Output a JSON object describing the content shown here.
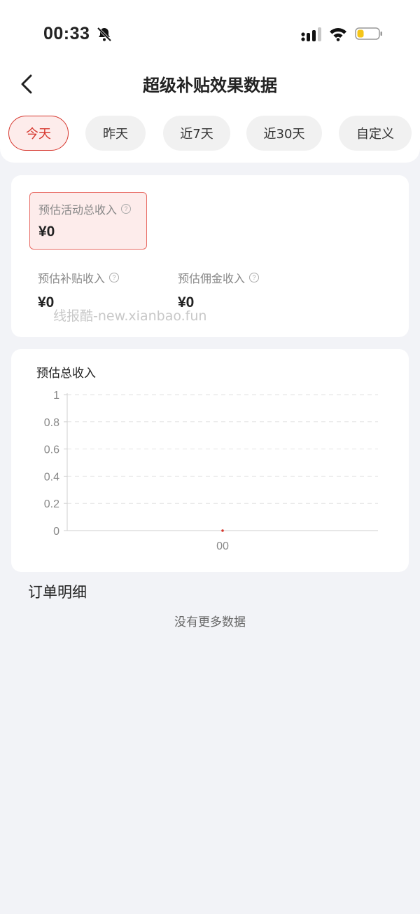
{
  "status_bar": {
    "time": "00:33"
  },
  "header": {
    "title": "超级补贴效果数据"
  },
  "tabs": [
    {
      "label": "今天",
      "active": true
    },
    {
      "label": "昨天",
      "active": false
    },
    {
      "label": "近7天",
      "active": false
    },
    {
      "label": "近30天",
      "active": false
    },
    {
      "label": "自定义",
      "active": false
    }
  ],
  "summary": {
    "total": {
      "label": "预估活动总收入",
      "value": "¥0"
    },
    "subsidy": {
      "label": "预估补贴收入",
      "value": "¥0"
    },
    "commission": {
      "label": "预估佣金收入",
      "value": "¥0"
    },
    "watermark": "线报酷-new.xianbao.fun"
  },
  "chart": {
    "title": "预估总收入"
  },
  "chart_data": {
    "type": "line",
    "title": "预估总收入",
    "categories": [
      "00"
    ],
    "series": [
      {
        "values": [
          0
        ]
      }
    ],
    "ylim": [
      0,
      1
    ],
    "yticks": [
      "1",
      "0.8",
      "0.6",
      "0.4",
      "0.2",
      "0"
    ],
    "grid": true,
    "colors": {
      "point": "#d6362d",
      "grid": "#e2e2e2",
      "axis": "#cfcfcf",
      "tick": "#888888"
    }
  },
  "orders": {
    "title": "订单明细",
    "empty_text": "没有更多数据"
  },
  "icons": {
    "help": "?"
  }
}
